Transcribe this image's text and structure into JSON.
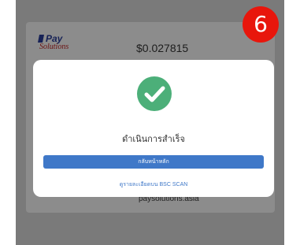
{
  "background": {
    "logo": {
      "line1": "Pay",
      "line2": "Solutions"
    },
    "amount": "$0.027815",
    "footer": "paysolutions.asia"
  },
  "badge": {
    "number": "6",
    "color": "#e8160c"
  },
  "modal": {
    "icon": "check-circle-icon",
    "icon_color": "#4caf79",
    "message": "ดำเนินการสำเร็จ",
    "primary_button": "กลับหน้าหลัก",
    "link": "ดูรายละเอียดบน BSC SCAN",
    "accent": "#3f78c8"
  }
}
